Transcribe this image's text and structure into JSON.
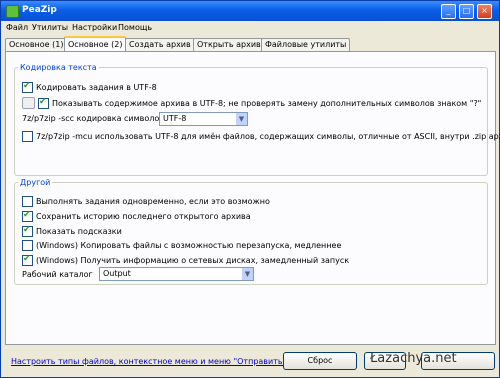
{
  "window": {
    "title": "PeaZip",
    "controls": [
      "_",
      "□",
      "×"
    ]
  },
  "menu": [
    "Файл",
    "Утилиты",
    "Настройки",
    "Помощь"
  ],
  "tabs": [
    {
      "label": "Основное (1)",
      "active": false
    },
    {
      "label": "Основное (2)",
      "active": true
    },
    {
      "label": "Создать архив",
      "active": false
    },
    {
      "label": "Открыть архив",
      "active": false
    },
    {
      "label": "Файловые утилиты",
      "active": false
    }
  ],
  "encoding_group": {
    "title": "Кодировка текста",
    "opt_utf8_tasks": {
      "label": "Кодировать задания в UTF-8",
      "checked": true
    },
    "opt_show_utf8": {
      "label": "Показывать содержимое архива в UTF-8; не проверять замену дополнительных символов знаком \"?\"",
      "checked": true
    },
    "scc_label": "7z/p7zip -scc кодировка символов",
    "scc_value": "UTF-8",
    "opt_mcu": {
      "label": "7z/p7zip -mcu использовать UTF-8 для имён файлов, содержащих символы, отличные от ASCII, внутри .zip архивов",
      "checked": false
    }
  },
  "other_group": {
    "title": "Другой",
    "options": [
      {
        "label": "Выполнять задания одновременно, если это возможно",
        "checked": false
      },
      {
        "label": "Сохранить историю последнего открытого архива",
        "checked": true
      },
      {
        "label": "Показать подсказки",
        "checked": true
      },
      {
        "label": "(Windows) Копировать файлы с возможностью перезапуска, медленнее",
        "checked": false
      },
      {
        "label": "(Windows) Получить информацию о сетевых дисках, замедленный запуск",
        "checked": true
      }
    ],
    "workdir_label": "Рабочий каталог",
    "workdir_value": "Output"
  },
  "footer": {
    "link": "Настроить типы файлов, контекстное меню и меню \"Отправить\"",
    "reset_label": "Сброс",
    "watermark": "Łazachya.net"
  }
}
